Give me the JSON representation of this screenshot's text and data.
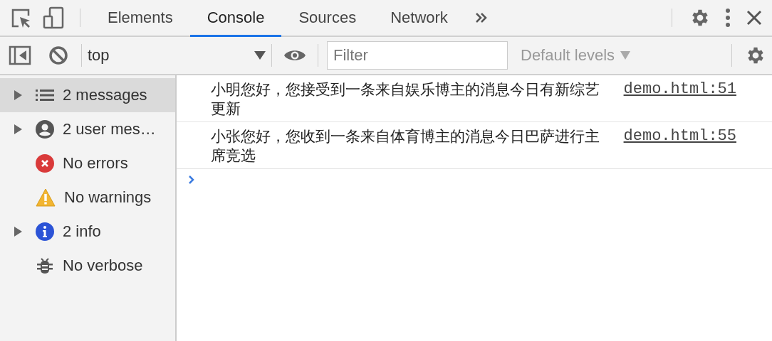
{
  "tabs": [
    {
      "label": "Elements",
      "selected": false
    },
    {
      "label": "Console",
      "selected": true
    },
    {
      "label": "Sources",
      "selected": false
    },
    {
      "label": "Network",
      "selected": false
    }
  ],
  "toolbar": {
    "context": "top",
    "filter": {
      "placeholder": "Filter"
    },
    "levels": "Default levels"
  },
  "sidebar": {
    "items": [
      {
        "kind": "list",
        "label": "2 messages",
        "expandable": true,
        "selected": true
      },
      {
        "kind": "user",
        "label": "2 user mes…",
        "expandable": true,
        "selected": false
      },
      {
        "kind": "error",
        "label": "No errors",
        "expandable": false,
        "selected": false
      },
      {
        "kind": "warning",
        "label": "No warnings",
        "expandable": false,
        "selected": false
      },
      {
        "kind": "info",
        "label": "2 info",
        "expandable": true,
        "selected": false
      },
      {
        "kind": "verbose",
        "label": "No verbose",
        "expandable": false,
        "selected": false
      }
    ]
  },
  "messages": [
    {
      "text": "小明您好，您接受到一条来自娱乐博主的消息今日有新综艺更新",
      "source": "demo.html:51"
    },
    {
      "text": "小张您好，您收到一条来自体育博主的消息今日巴萨进行主席竞选",
      "source": "demo.html:55"
    }
  ]
}
